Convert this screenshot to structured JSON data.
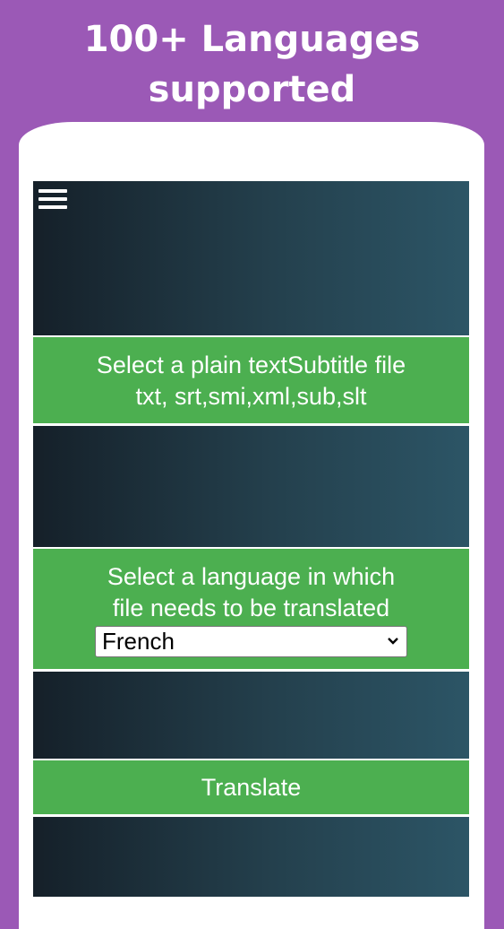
{
  "promo": {
    "line1": "100+ Languages",
    "line2": "supported"
  },
  "menu": {
    "icon": "hamburger-menu-icon"
  },
  "file_select": {
    "line1": "Select a plain textSubtitle file",
    "line2": "txt, srt,smi,xml,sub,slt"
  },
  "language": {
    "line1": "Select a language in which",
    "line2": "file needs to be translated",
    "selected": "French"
  },
  "translate": {
    "label": "Translate"
  },
  "colors": {
    "background": "#9b59b6",
    "accent_green": "#4caf50",
    "dark_panel": "#1c2e38"
  }
}
